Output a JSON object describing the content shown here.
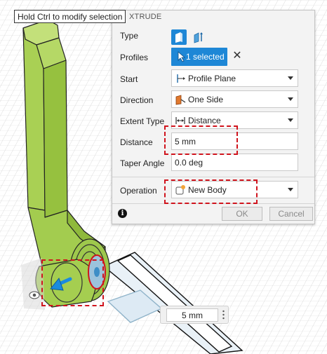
{
  "tooltip": "Hold Ctrl to modify selection",
  "dialog": {
    "title_fragment": "XTRUDE",
    "type": {
      "label": "Type",
      "options": [
        "extrude-solid-icon",
        "extrude-thin-icon"
      ],
      "selected": 0
    },
    "profiles": {
      "label": "Profiles",
      "value": "1 selected"
    },
    "start": {
      "label": "Start",
      "value": "Profile Plane"
    },
    "direction": {
      "label": "Direction",
      "value": "One Side"
    },
    "extent_type": {
      "label": "Extent Type",
      "value": "Distance"
    },
    "distance": {
      "label": "Distance",
      "value": "5 mm"
    },
    "taper_angle": {
      "label": "Taper Angle",
      "value": "0.0 deg"
    },
    "operation": {
      "label": "Operation",
      "value": "New Body"
    },
    "ok_label": "OK",
    "cancel_label": "Cancel"
  },
  "viewport_distance": "5 mm",
  "colors": {
    "accent": "#1e87d6",
    "body_green": "#a7cf4b",
    "profile_blue": "#9cc3dc",
    "highlight": "#d0141d",
    "arrow": "#1a8be0"
  }
}
